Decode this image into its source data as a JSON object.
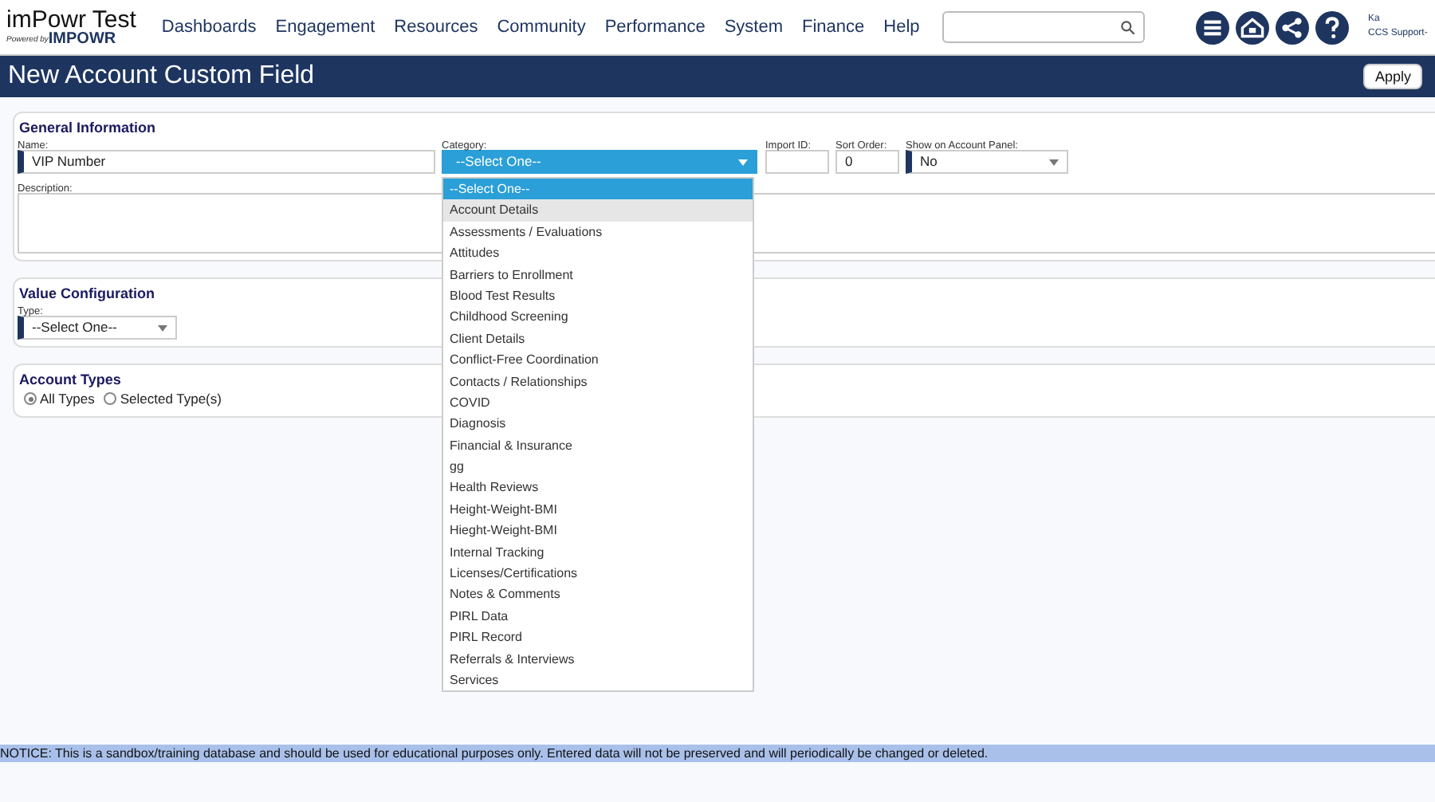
{
  "header": {
    "app_title": "imPowr Test",
    "powered_by": "Powered by",
    "brand": "IMPOWR",
    "nav": [
      "Dashboards",
      "Engagement",
      "Resources",
      "Community",
      "Performance",
      "System",
      "Finance",
      "Help"
    ],
    "user": {
      "name": "Ka",
      "org": "CCS Support-"
    }
  },
  "title_bar": {
    "title": "New Account Custom Field",
    "buttons": [
      "Apply"
    ]
  },
  "general_information": {
    "heading": "General Information",
    "fields": [
      {
        "kind": "text",
        "label": "Name:",
        "value": "VIP Number",
        "required": true
      },
      {
        "kind": "select",
        "label": "Category:",
        "value": "--Select One--",
        "required": true,
        "open": true
      },
      {
        "kind": "text",
        "label": "Import ID:",
        "required": false
      },
      {
        "kind": "text",
        "label": "Sort Order:",
        "value": "0",
        "required": false
      },
      {
        "kind": "select",
        "label": "Show on Account Panel:",
        "value": "No",
        "required": true,
        "open": false
      }
    ],
    "description": {
      "label": "Description:"
    }
  },
  "value_configuration": {
    "heading": "Value Configuration",
    "type": {
      "label": "Type:",
      "value": "--Select One--"
    }
  },
  "account_types": {
    "heading": "Account Types",
    "options": [
      {
        "label": "All Types",
        "selected": true
      },
      {
        "label": "Selected Type(s)",
        "selected": false
      }
    ]
  },
  "category_dropdown": [
    {
      "label": "--Select One--",
      "selected": true,
      "hovered": false
    },
    {
      "label": "Account Details",
      "selected": false,
      "hovered": true
    },
    {
      "label": "Assessments / Evaluations",
      "selected": false,
      "hovered": false
    },
    {
      "label": "Attitudes",
      "selected": false,
      "hovered": false
    },
    {
      "label": "Barriers to Enrollment",
      "selected": false,
      "hovered": false
    },
    {
      "label": "Blood Test Results",
      "selected": false,
      "hovered": false
    },
    {
      "label": "Childhood Screening",
      "selected": false,
      "hovered": false
    },
    {
      "label": "Client Details",
      "selected": false,
      "hovered": false
    },
    {
      "label": "Conflict-Free Coordination",
      "selected": false,
      "hovered": false
    },
    {
      "label": "Contacts / Relationships",
      "selected": false,
      "hovered": false
    },
    {
      "label": "COVID",
      "selected": false,
      "hovered": false
    },
    {
      "label": "Diagnosis",
      "selected": false,
      "hovered": false
    },
    {
      "label": "Financial & Insurance",
      "selected": false,
      "hovered": false
    },
    {
      "label": "gg",
      "selected": false,
      "hovered": false
    },
    {
      "label": "Health Reviews",
      "selected": false,
      "hovered": false
    },
    {
      "label": "Height-Weight-BMI",
      "selected": false,
      "hovered": false
    },
    {
      "label": "Hieght-Weight-BMI",
      "selected": false,
      "hovered": false
    },
    {
      "label": "Internal Tracking",
      "selected": false,
      "hovered": false
    },
    {
      "label": "Licenses/Certifications",
      "selected": false,
      "hovered": false
    },
    {
      "label": "Notes & Comments",
      "selected": false,
      "hovered": false
    },
    {
      "label": "PIRL Data",
      "selected": false,
      "hovered": false
    },
    {
      "label": "PIRL Record",
      "selected": false,
      "hovered": false
    },
    {
      "label": "Referrals & Interviews",
      "selected": false,
      "hovered": false
    },
    {
      "label": "Services",
      "selected": false,
      "hovered": false
    }
  ],
  "notice": "NOTICE: This is a sandbox/training database and should be used for educational purposes only. Entered data will not be preserved and will periodically be changed or deleted."
}
